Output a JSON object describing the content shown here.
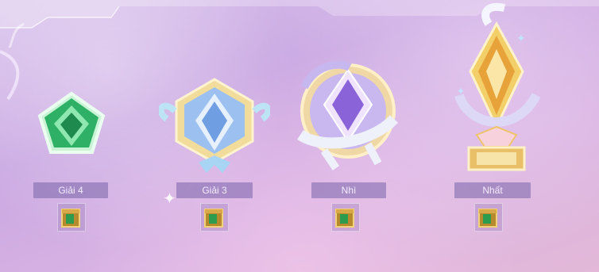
{
  "awards": [
    {
      "id": "4",
      "label": "Giải 4",
      "emblem": "green-pentagon-badge-icon",
      "reward": "treasure-chest-icon"
    },
    {
      "id": "3",
      "label": "Giải 3",
      "emblem": "blue-bow-badge-icon",
      "reward": "treasure-chest-icon"
    },
    {
      "id": "2",
      "label": "Nhì",
      "emblem": "purple-ribbon-medal-icon",
      "reward": "treasure-chest-icon"
    },
    {
      "id": "1",
      "label": "Nhất",
      "emblem": "gold-winged-trophy-icon",
      "reward": "treasure-chest-icon"
    }
  ],
  "colors": {
    "label_bg": "#7864aa",
    "label_text": "#f3ecff",
    "green": "#2fb067",
    "blue": "#6f9ee2",
    "purple": "#8a63d8",
    "gold": "#e7b23c"
  }
}
